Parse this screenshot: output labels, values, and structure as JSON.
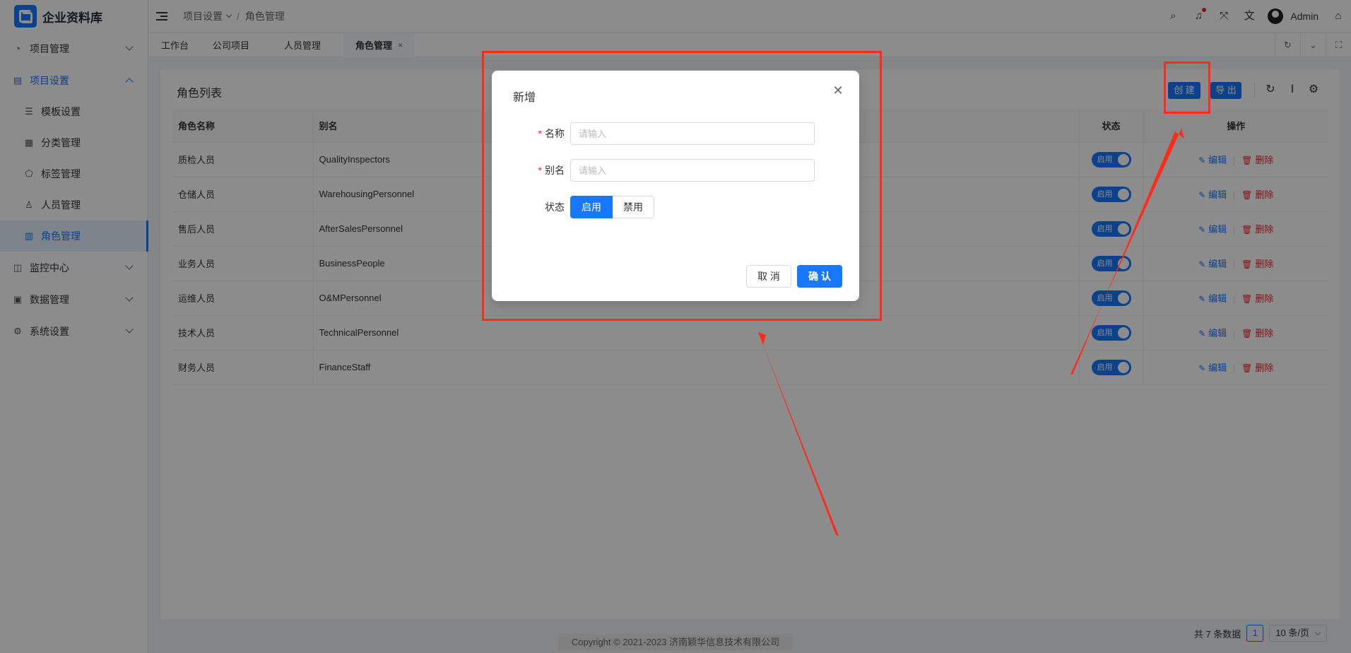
{
  "app": {
    "title": "企业资料库"
  },
  "sidebar": {
    "menus": [
      {
        "label": "项目管理",
        "icon": "dashboard-icon"
      },
      {
        "label": "项目设置",
        "icon": "document-icon",
        "open": true
      },
      {
        "label": "监控中心",
        "icon": "monitor-icon"
      },
      {
        "label": "数据管理",
        "icon": "database-icon"
      },
      {
        "label": "系统设置",
        "icon": "gear-icon"
      }
    ],
    "sub_items": [
      {
        "label": "模板设置",
        "icon": "list-icon"
      },
      {
        "label": "分类管理",
        "icon": "grid-icon"
      },
      {
        "label": "标签管理",
        "icon": "tag-icon"
      },
      {
        "label": "人员管理",
        "icon": "user-icon"
      },
      {
        "label": "角色管理",
        "icon": "role-icon",
        "active": true
      }
    ]
  },
  "header": {
    "breadcrumb": [
      "项目设置",
      "/",
      "角色管理"
    ],
    "user": "Admin"
  },
  "tabs": [
    {
      "label": "工作台"
    },
    {
      "label": "公司项目"
    },
    {
      "label": "人员管理"
    },
    {
      "label": "角色管理",
      "active": true,
      "close": "×"
    }
  ],
  "card": {
    "title": "角色列表",
    "create_label": "创 建",
    "export_label": "导 出"
  },
  "table": {
    "columns": [
      "角色名称",
      "别名",
      "状态",
      "操作"
    ],
    "rows": [
      {
        "name": "质检人员",
        "alias": "QualityInspectors",
        "status": "启用"
      },
      {
        "name": "仓储人员",
        "alias": "WarehousingPersonnel",
        "status": "启用"
      },
      {
        "name": "售后人员",
        "alias": "AfterSalesPersonnel",
        "status": "启用"
      },
      {
        "name": "业务人员",
        "alias": "BusinessPeople",
        "status": "启用"
      },
      {
        "name": "运维人员",
        "alias": "O&MPersonnel",
        "status": "启用"
      },
      {
        "name": "技术人员",
        "alias": "TechnicalPersonnel",
        "status": "启用"
      },
      {
        "name": "财务人员",
        "alias": "FinanceStaff",
        "status": "启用"
      }
    ],
    "edit_label": "编辑",
    "delete_label": "删除"
  },
  "pagination": {
    "total_text": "共 7 条数据",
    "page": "1",
    "page_size": "10 条/页"
  },
  "footer": {
    "copyright": "Copyright © 2021-2023 济南颖华信息技术有限公司"
  },
  "modal": {
    "title": "新增",
    "name_label": "名称",
    "name_placeholder": "请输入",
    "alias_label": "别名",
    "alias_placeholder": "请输入",
    "status_label": "状态",
    "status_enabled": "启用",
    "status_disabled": "禁用",
    "required_mark": "*",
    "cancel_label": "取 消",
    "ok_label": "确 认"
  },
  "colors": {
    "primary": "#1677ff",
    "danger": "#f5222d",
    "annotation": "#ff2a1a"
  }
}
